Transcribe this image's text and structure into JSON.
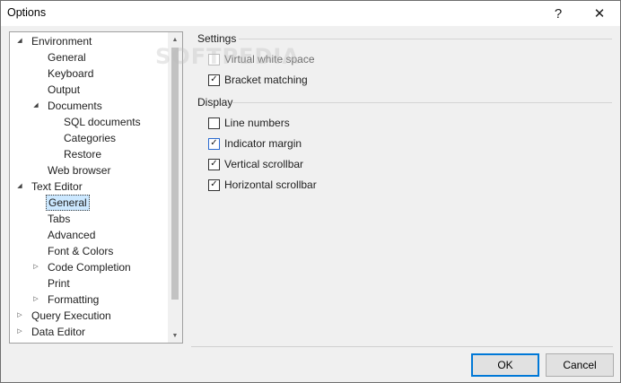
{
  "window": {
    "title": "Options",
    "help_glyph": "?",
    "close_glyph": "✕"
  },
  "watermark": "SOFTPEDIA",
  "tree": {
    "expanded_glyph": "◢",
    "collapsed_glyph": "▷",
    "selected_label": "General",
    "items": [
      {
        "label": "Environment",
        "level": 0,
        "arrow": "expanded"
      },
      {
        "label": "General",
        "level": 1,
        "arrow": ""
      },
      {
        "label": "Keyboard",
        "level": 1,
        "arrow": ""
      },
      {
        "label": "Output",
        "level": 1,
        "arrow": ""
      },
      {
        "label": "Documents",
        "level": 1,
        "arrow": "expanded"
      },
      {
        "label": "SQL documents",
        "level": 2,
        "arrow": ""
      },
      {
        "label": "Categories",
        "level": 2,
        "arrow": ""
      },
      {
        "label": "Restore",
        "level": 2,
        "arrow": ""
      },
      {
        "label": "Web browser",
        "level": 1,
        "arrow": ""
      },
      {
        "label": "Text Editor",
        "level": 0,
        "arrow": "expanded"
      },
      {
        "label": "General",
        "level": 1,
        "arrow": "",
        "selected": true
      },
      {
        "label": "Tabs",
        "level": 1,
        "arrow": ""
      },
      {
        "label": "Advanced",
        "level": 1,
        "arrow": ""
      },
      {
        "label": "Font & Colors",
        "level": 1,
        "arrow": ""
      },
      {
        "label": "Code Completion",
        "level": 1,
        "arrow": "collapsed"
      },
      {
        "label": "Print",
        "level": 1,
        "arrow": ""
      },
      {
        "label": "Formatting",
        "level": 1,
        "arrow": "collapsed"
      },
      {
        "label": "Query Execution",
        "level": 0,
        "arrow": "collapsed"
      },
      {
        "label": "Data Editor",
        "level": 0,
        "arrow": "collapsed"
      }
    ],
    "scrollbar": {
      "up_glyph": "▲",
      "down_glyph": "▼"
    }
  },
  "settings": {
    "header": "Settings",
    "options": [
      {
        "label": "Virtual white space",
        "checked": false,
        "enabled": false
      },
      {
        "label": "Bracket matching",
        "checked": true,
        "enabled": true
      }
    ]
  },
  "display": {
    "header": "Display",
    "options": [
      {
        "label": "Line numbers",
        "checked": false,
        "enabled": true
      },
      {
        "label": "Indicator margin",
        "checked": true,
        "enabled": true,
        "focused": true
      },
      {
        "label": "Vertical scrollbar",
        "checked": true,
        "enabled": true
      },
      {
        "label": "Horizontal scrollbar",
        "checked": true,
        "enabled": true
      }
    ]
  },
  "buttons": {
    "ok": "OK",
    "cancel": "Cancel"
  },
  "check_glyph": "✓"
}
